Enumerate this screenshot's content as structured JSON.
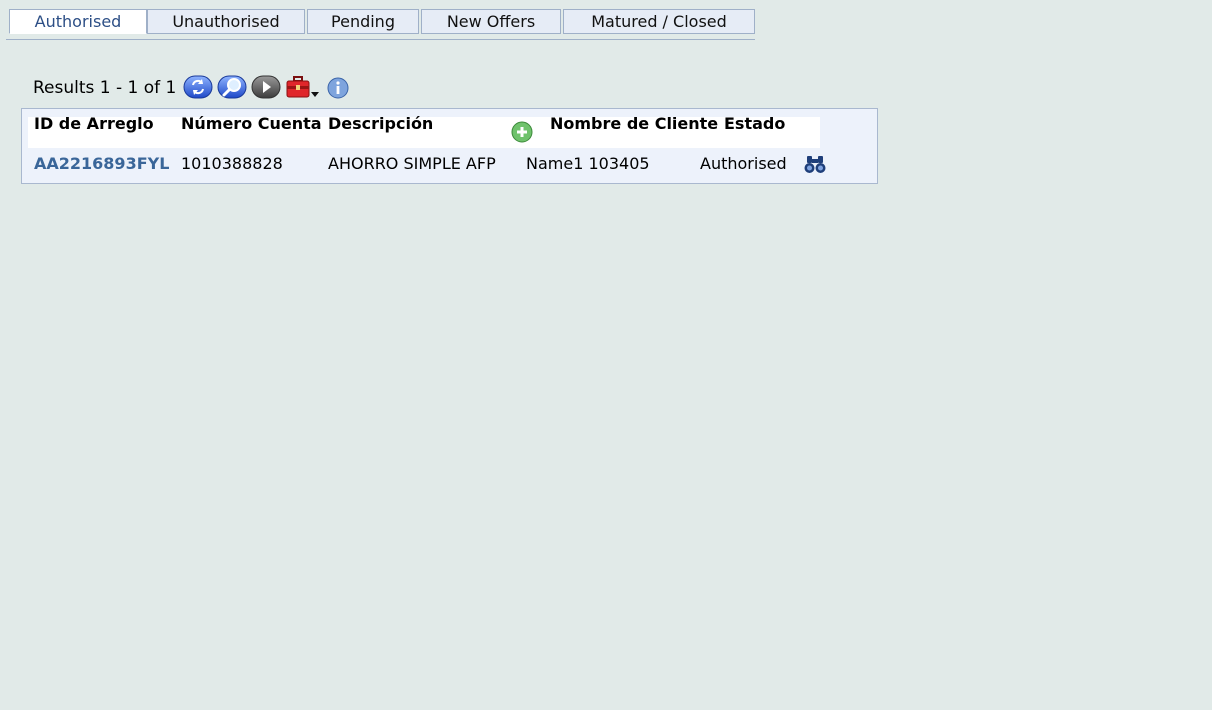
{
  "tabs": [
    {
      "label": "Authorised",
      "active": true
    },
    {
      "label": "Unauthorised",
      "active": false
    },
    {
      "label": "Pending",
      "active": false
    },
    {
      "label": "New Offers",
      "active": false
    },
    {
      "label": "Matured / Closed",
      "active": false
    }
  ],
  "toolbar": {
    "results_text": "Results 1 - 1 of 1",
    "icons": [
      "refresh-icon",
      "search-icon",
      "next-icon",
      "toolbox-icon",
      "info-icon"
    ]
  },
  "table": {
    "columns": [
      "ID de Arreglo",
      "Número Cuenta",
      "Descripción",
      "Nombre de Cliente",
      "Estado"
    ],
    "rows": [
      {
        "id": "AA2216893FYL",
        "account": "1010388828",
        "description": "AHORRO SIMPLE AFP",
        "client": "Name1 103405",
        "status": "Authorised"
      }
    ]
  },
  "colors": {
    "background": "#e1eae8",
    "tab_bg": "#e6ecf6",
    "tab_border": "#9fb0c8",
    "link": "#3a6699",
    "panel_bg": "#edf2fb"
  }
}
